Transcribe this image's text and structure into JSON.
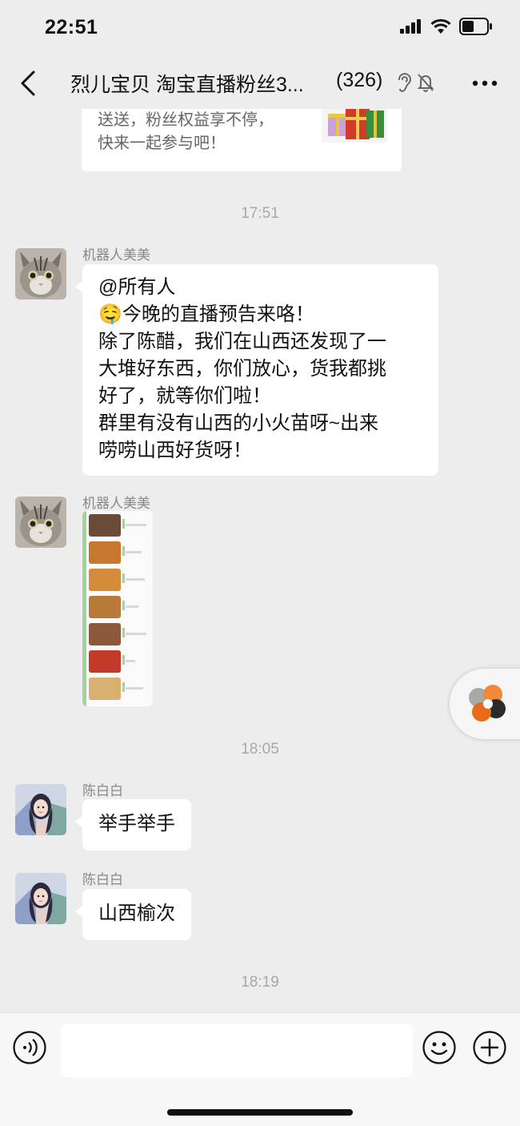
{
  "status": {
    "time": "22:51"
  },
  "nav": {
    "title": "烈儿宝贝 淘宝直播粉丝3...",
    "count": "(326)",
    "icons": [
      "back-icon",
      "ear-icon",
      "mute-icon",
      "more-icon"
    ]
  },
  "chat": {
    "previous_card_text": [
      "送送，粉丝权益享不停，",
      "快来一起参与吧！"
    ],
    "timestamps": [
      "17:51",
      "18:05",
      "18:19"
    ],
    "messages": [
      {
        "sender": "机器人美美",
        "lines": [
          "@所有人",
          "🤤今晚的直播预告来咯！",
          "除了陈醋，我们在山西还发现了一",
          "大堆好东西，你们放心，货我都挑",
          "好了，就等你们啦！",
          "群里有没有山西的小火苗呀~出来",
          "唠唠山西好货呀！"
        ]
      },
      {
        "sender": "机器人美美",
        "kind": "image"
      },
      {
        "sender": "陈白白",
        "text": "举手举手"
      },
      {
        "sender": "陈白白",
        "text": "山西榆次"
      }
    ]
  },
  "input": {
    "value": "",
    "placeholder": ""
  },
  "colors": {
    "background": "#ededed",
    "bubble": "#ffffff",
    "timestamp": "#a8a8a8",
    "sender": "#888888"
  }
}
